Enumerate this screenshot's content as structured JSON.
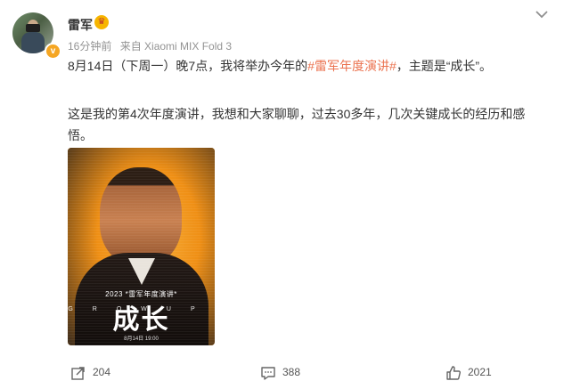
{
  "author": {
    "name": "雷军",
    "avatar_icon": "avatar-photo",
    "verified_badge": "v"
  },
  "meta": {
    "time": "16分钟前",
    "source": "来自 Xiaomi MIX Fold 3"
  },
  "content": {
    "line1_prefix": "8月14日（下周一）晚7点，我将举办今年的",
    "hashtag": "#雷军年度演讲#",
    "line1_suffix": "，主题是“成长”。",
    "line2": "这是我的第4次年度演讲，我想和大家聊聊，过去30多年，几次关键成长的经历和感悟。"
  },
  "poster": {
    "event_line": "2023 *雷军年度演讲*",
    "en_word": "GROWUP",
    "cn_title": "成长",
    "date": "8月14日 19:00"
  },
  "actions": {
    "share_count": "204",
    "comment_count": "388",
    "like_count": "2021"
  },
  "colors": {
    "hashtag": "#eb7350",
    "poster_orange": "#f29a1c",
    "meta_gray": "#939393"
  }
}
